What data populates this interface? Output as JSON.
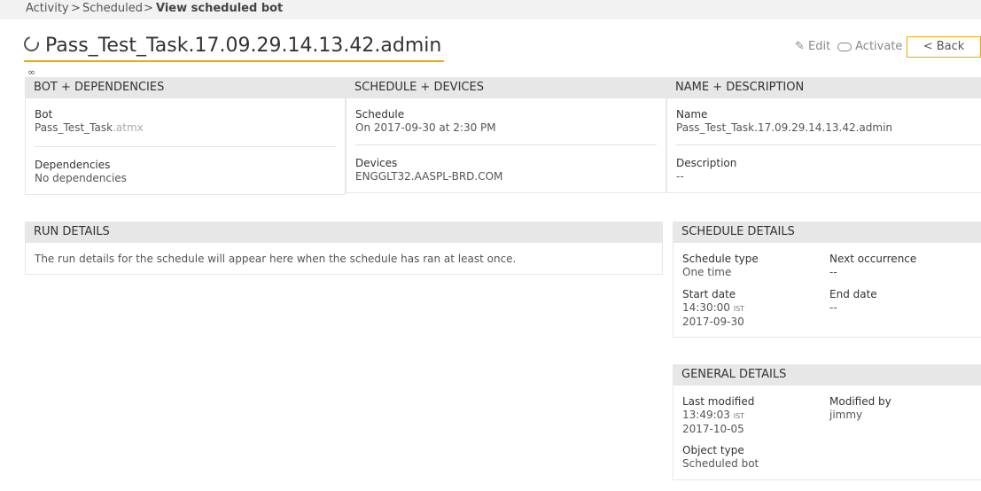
{
  "breadcrumb": {
    "items": [
      "Activity",
      ">",
      "Scheduled",
      ">",
      "View scheduled bot"
    ]
  },
  "title": "Pass_Test_Task.17.09.29.14.13.42.admin",
  "actions": {
    "edit": "Edit",
    "activate": "Activate",
    "back": "< Back"
  },
  "bot_deps": {
    "header": "BOT + DEPENDENCIES",
    "bot_label": "Bot",
    "bot_name": "Pass_Test_Task",
    "bot_ext": ".atmx",
    "deps_label": "Dependencies",
    "deps_value": "No dependencies"
  },
  "schedule_devices": {
    "header": "SCHEDULE + DEVICES",
    "schedule_label": "Schedule",
    "schedule_value": "On 2017-09-30 at 2:30 PM",
    "devices_label": "Devices",
    "devices_value": "ENGGLT32.AASPL-BRD.COM"
  },
  "name_desc": {
    "header": "NAME + DESCRIPTION",
    "name_label": "Name",
    "name_value": "Pass_Test_Task.17.09.29.14.13.42.admin",
    "desc_label": "Description",
    "desc_value": "--"
  },
  "run_details": {
    "header": "RUN DETAILS",
    "message": "The run details for the schedule will appear here when the schedule has ran at least once."
  },
  "schedule_details": {
    "header": "SCHEDULE DETAILS",
    "type_label": "Schedule type",
    "type_value": "One time",
    "next_label": "Next occurrence",
    "next_value": "--",
    "start_label": "Start date",
    "start_time": "14:30:00",
    "start_tz": "IST",
    "start_date": "2017-09-30",
    "end_label": "End date",
    "end_value": "--"
  },
  "general_details": {
    "header": "GENERAL DETAILS",
    "modified_label": "Last modified",
    "modified_time": "13:49:03",
    "modified_tz": "IST",
    "modified_date": "2017-10-05",
    "by_label": "Modified by",
    "by_value": "jimmy",
    "objtype_label": "Object type",
    "objtype_value": "Scheduled bot"
  },
  "colors": {
    "accent": "#f2a900",
    "header_bg": "#e7e7e7"
  }
}
